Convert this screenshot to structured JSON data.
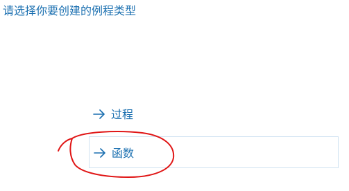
{
  "dialog": {
    "prompt": "请选择你要创建的例程类型"
  },
  "options": [
    {
      "label": "过程",
      "icon": "arrow-right-icon",
      "selected": false
    },
    {
      "label": "函数",
      "icon": "arrow-right-icon",
      "selected": true
    }
  ],
  "colors": {
    "link_blue": "#1a6fb0",
    "selection_border": "#cfe2f1",
    "annotation_red": "#e01515"
  }
}
